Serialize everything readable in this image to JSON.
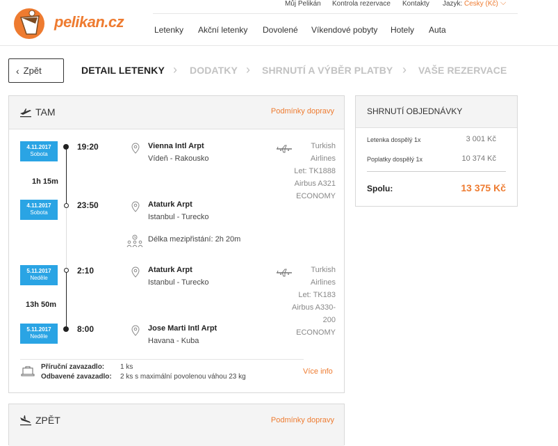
{
  "brand": {
    "name": "pelikan.cz"
  },
  "top_links": {
    "account": "Můj Pelikán",
    "check": "Kontrola rezervace",
    "contacts": "Kontakty",
    "lang_label": "Jazyk:",
    "lang_value": "Česky (Kč)"
  },
  "nav": [
    "Letenky",
    "Akční letenky",
    "Dovolené",
    "Víkendové pobyty",
    "Hotely",
    "Auta"
  ],
  "back": "Zpět",
  "steps": [
    "DETAIL LETENKY",
    "DODATKY",
    "SHRNUTÍ A VÝBĚR PLATBY",
    "VAŠE REZERVACE"
  ],
  "outbound": {
    "title": "TAM",
    "conditions": "Podmínky dopravy",
    "segments": [
      {
        "dep_date": "4.11.2017",
        "dep_day": "Sobota",
        "dep_time": "19:20",
        "dep_airport": "Vienna Intl Arpt",
        "dep_city": "Vídeň - Rakousko",
        "duration": "1h 15m",
        "arr_date": "4.11.2017",
        "arr_day": "Sobota",
        "arr_time": "23:50",
        "arr_airport": "Ataturk Arpt",
        "arr_city": "Istanbul - Turecko",
        "carrier": [
          "Turkish",
          "Airlines",
          "Let: TK1888",
          "Airbus A321",
          "ECONOMY"
        ]
      },
      {
        "dep_date": "5.11.2017",
        "dep_day": "Neděle",
        "dep_time": "2:10",
        "dep_airport": "Ataturk Arpt",
        "dep_city": "Istanbul - Turecko",
        "duration": "13h 50m",
        "arr_date": "5.11.2017",
        "arr_day": "Neděle",
        "arr_time": "8:00",
        "arr_airport": "Jose Marti Intl Arpt",
        "arr_city": "Havana - Kuba",
        "carrier": [
          "Turkish",
          "Airlines",
          "Let: TK183",
          "Airbus A330-",
          "200",
          "ECONOMY"
        ]
      }
    ],
    "layover": "Délka mezipřistání: 2h 20m",
    "baggage": {
      "hand_label": "Příruční zavazadlo:",
      "hand_value": "1 ks",
      "checked_label": "Odbavené zavazadlo:",
      "checked_value": "2 ks s maximální povolenou váhou 23 kg",
      "more": "Více info"
    }
  },
  "return": {
    "title": "ZPĚT",
    "conditions": "Podmínky dopravy"
  },
  "summary": {
    "title": "SHRNUTÍ OBJEDNÁVKY",
    "rows": [
      {
        "label": "Letenka dospělý 1x",
        "value": "3 001 Kč"
      },
      {
        "label": "Poplatky dospělý 1x",
        "value": "10 374 Kč"
      }
    ],
    "total_label": "Spolu:",
    "total_value": "13 375 Kč"
  },
  "colors": {
    "accent": "#ee7b30",
    "date_badge": "#2aa4e4"
  }
}
